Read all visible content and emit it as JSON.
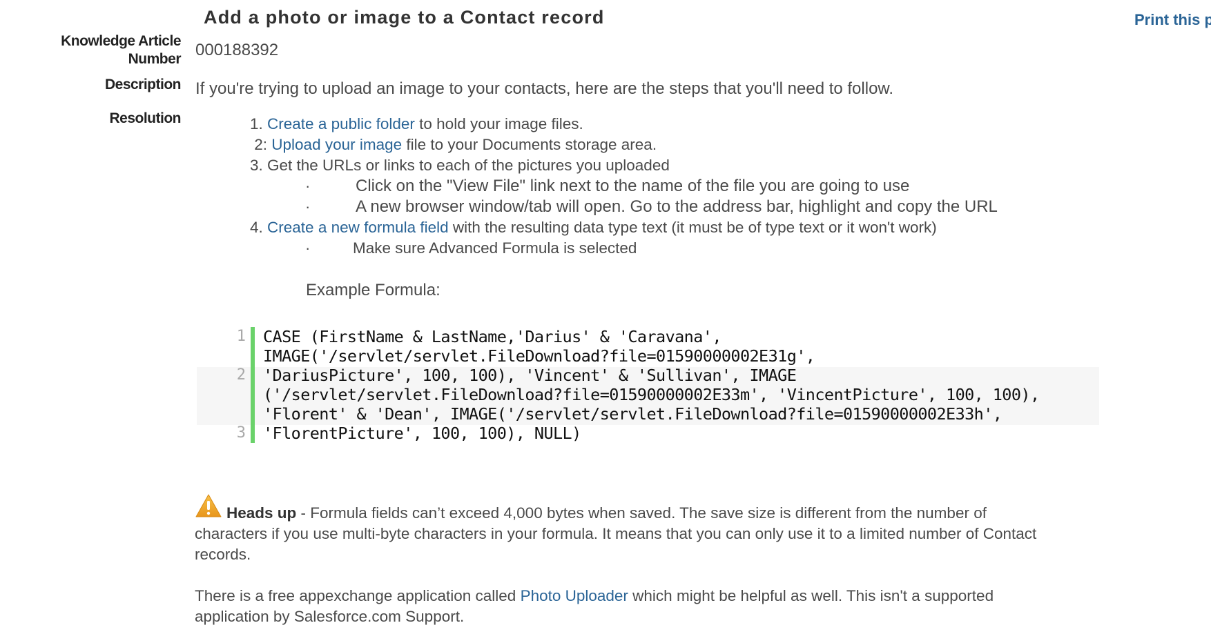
{
  "article": {
    "title": "Add a photo or image to a Contact record",
    "print_link": "Print this p",
    "fields": {
      "number_label_line1": "Knowledge Article",
      "number_label_line2": "Number",
      "number_value": "000188392",
      "description_label": "Description",
      "description_value": "If you're trying to upload an image to your contacts, here are the steps that you'll need to follow.",
      "resolution_label": "Resolution"
    },
    "resolution": {
      "step1": {
        "prefix": "1. ",
        "link": "Create a public folder",
        "rest": " to hold your image files."
      },
      "step2": {
        "prefix": " 2: ",
        "link": "Upload your image",
        "rest": " file to your Documents storage area."
      },
      "step3": {
        "text": "3. Get the URLs or links to each of the pictures you uploaded"
      },
      "step3_bullets": [
        "Click on the \"View File\" link next to the name of the file you are going to use",
        "A new browser window/tab will open. Go to the address bar, highlight and copy the URL"
      ],
      "step4": {
        "prefix": "4. ",
        "link": "Create a new formula field",
        "rest": " with the resulting data type text (it must be of type text or it won't work)"
      },
      "step4_bullets": [
        "Make sure Advanced Formula is selected"
      ],
      "bullet_glyph": "·",
      "example_label": "Example Formula:"
    },
    "code": {
      "line_numbers": [
        "1",
        "2",
        "3"
      ],
      "lines": [
        "CASE (FirstName & LastName,'Darius' & 'Caravana',",
        "IMAGE('/servlet/servlet.FileDownload?file=01590000002E31g',",
        "'DariusPicture', 100, 100), 'Vincent' & 'Sullivan', IMAGE",
        "('/servlet/servlet.FileDownload?file=01590000002E33m', 'VincentPicture', 100, 100),",
        "'Florent' & 'Dean', IMAGE('/servlet/servlet.FileDownload?file=01590000002E33h',",
        "'FlorentPicture', 100, 100), NULL)"
      ]
    },
    "heads_up": {
      "icon": "warning-icon",
      "title": "Heads up",
      "line1": " - Formula fields can’t exceed 4,000 bytes when saved. The save size is different from the number of",
      "line2": "characters if you use multi-byte characters in your formula. It means that you can only use it to a limited number of Contact",
      "line3": "records."
    },
    "footer_note": {
      "line1_prefix": "There is a free appexchange application called ",
      "link": "Photo Uploader",
      "line1_suffix": " which might be helpful as well. This isn't a supported",
      "line2": "application by Salesforce.com Support."
    },
    "colors": {
      "link": "#2a6496",
      "gutter_bar": "#6ad26a",
      "warning": "#f0a830"
    }
  }
}
